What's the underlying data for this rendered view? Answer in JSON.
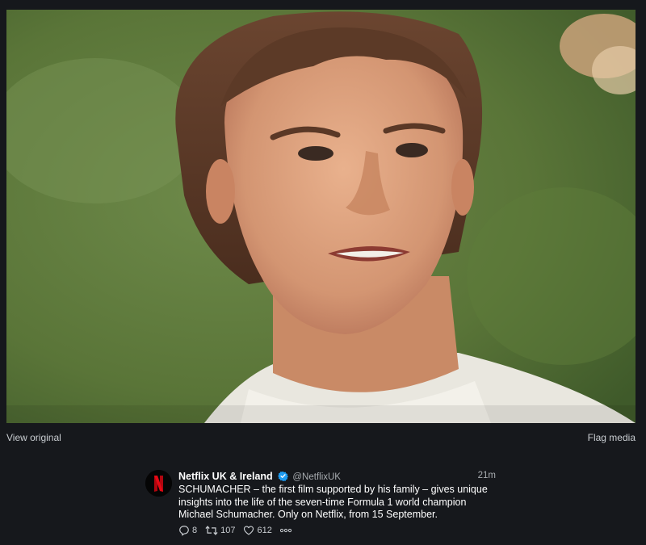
{
  "media": {
    "image_alt": "Portrait of Michael Schumacher smiling outdoors",
    "view_original_label": "View original",
    "flag_media_label": "Flag media"
  },
  "tweet": {
    "display_name": "Netflix UK & Ireland",
    "handle": "@NetflixUK",
    "timestamp": "21m",
    "verified": true,
    "text_lines": [
      "SCHUMACHER – the first film supported by his family – gives unique",
      "insights into the life of the seven-time Formula 1 world champion",
      "Michael Schumacher. Only on Netflix, from 15 September."
    ],
    "reply_count": "8",
    "retweet_count": "107",
    "like_count": "612",
    "more_label": "°°°"
  },
  "icons": {
    "reply": "reply-icon",
    "retweet": "retweet-icon",
    "like": "heart-icon",
    "more": "more-icon",
    "verified": "verified-badge-icon"
  },
  "colors": {
    "background": "#16181c",
    "netflix_red": "#e50914",
    "verified_blue": "#1d9bf0",
    "muted_text": "#a8acb0"
  }
}
